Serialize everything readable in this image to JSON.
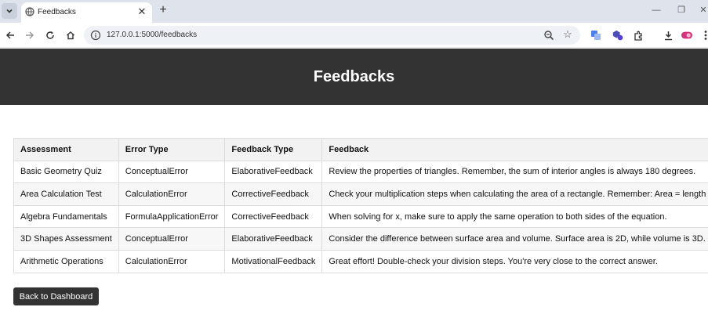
{
  "browser": {
    "tab_title": "Feedbacks",
    "tab_close": "✕",
    "new_tab": "+",
    "url": "127.0.0.1:5000/feedbacks",
    "window_controls": {
      "minimize": "—",
      "restore": "❐",
      "close": "✕"
    },
    "extension_badge": "2"
  },
  "page": {
    "title": "Feedbacks",
    "table": {
      "headers": [
        "Assessment",
        "Error Type",
        "Feedback Type",
        "Feedback"
      ],
      "rows": [
        [
          "Basic Geometry Quiz",
          "ConceptualError",
          "ElaborativeFeedback",
          "Review the properties of triangles. Remember, the sum of interior angles is always 180 degrees."
        ],
        [
          "Area Calculation Test",
          "CalculationError",
          "CorrectiveFeedback",
          "Check your multiplication steps when calculating the area of a rectangle. Remember: Area = length * width."
        ],
        [
          "Algebra Fundamentals",
          "FormulaApplicationError",
          "CorrectiveFeedback",
          "When solving for x, make sure to apply the same operation to both sides of the equation."
        ],
        [
          "3D Shapes Assessment",
          "ConceptualError",
          "ElaborativeFeedback",
          "Consider the difference between surface area and volume. Surface area is 2D, while volume is 3D."
        ],
        [
          "Arithmetic Operations",
          "CalculationError",
          "MotivationalFeedback",
          "Great effort! Double-check your division steps. You're very close to the correct answer."
        ]
      ]
    },
    "back_button_label": "Back to Dashboard"
  },
  "colors": {
    "header_bg": "#333333",
    "button_bg": "#333333",
    "table_header_bg": "#f2f2f2",
    "tabstrip_bg": "#dfe3eb"
  }
}
